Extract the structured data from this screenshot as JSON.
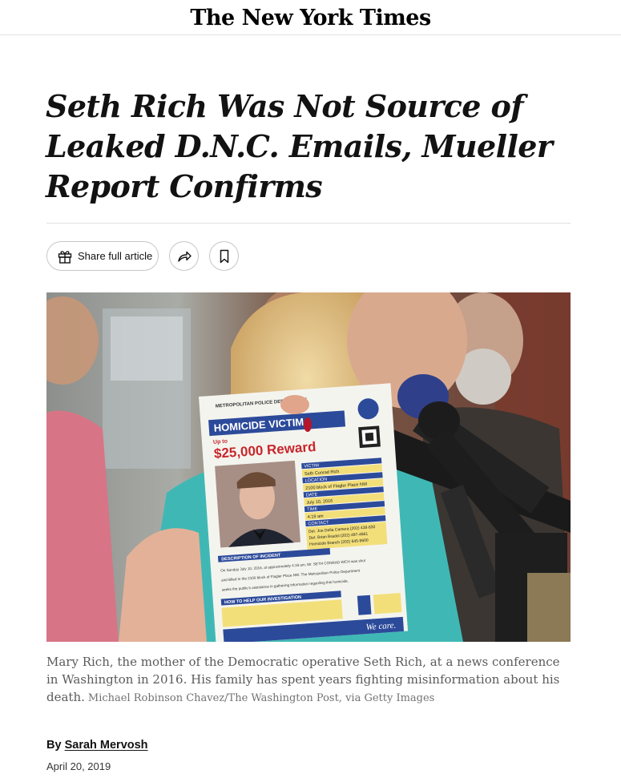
{
  "masthead": {
    "logo_text": "The New York Times"
  },
  "article": {
    "headline": "Seth Rich Was Not Source of Leaked D.N.C. Emails, Mueller Report Confirms",
    "toolbar": {
      "share_label": "Share full article"
    },
    "photo": {
      "poster": {
        "department": "METROPOLITAN POLICE DEPARTMENT",
        "banner": "HOMICIDE VICTIM",
        "up_to": "Up to",
        "reward": "$25,000 Reward",
        "fields": [
          "VICTIM",
          "Seth Conrad Rich",
          "LOCATION",
          "2100 block of Flagler Place NW",
          "DATE",
          "July 10, 2016",
          "TIME",
          "4:19 am",
          "CONTACT"
        ],
        "contacts": [
          "Det. Joe Della Camera  (202) 438-830",
          "Det. Brian Bradol  (202) 497-4661",
          "Homicide Branch  (202) 645-9600"
        ],
        "incident_heading": "DESCRIPTION OF INCIDENT",
        "incident_text": [
          "On Sunday July 10, 2016, at approximately 4:19 am, Mr. SETH CONRAD RICH was shot",
          "and killed in the 2100 block of Flagler Place NW. The Metropolitan Police Department",
          "seeks the public's assistance in gathering information regarding this homicide."
        ],
        "help_heading": "HOW TO HELP OUR INVESTIGATION",
        "footer": "We care."
      }
    },
    "caption": {
      "text": "Mary Rich, the mother of the Democratic operative Seth Rich, at a news conference in Washington in 2016. His family has spent years fighting misinformation about his death.",
      "credit": "Michael Robinson Chavez/The Washington Post, via Getty Images"
    },
    "byline": {
      "prefix": "By",
      "author": "Sarah Mervosh"
    },
    "date": "April 20, 2019"
  },
  "colors": {
    "text": "#121212",
    "caption": "#5a5a5a",
    "rule": "#dfdfdf",
    "poster_banner": "#2c4a9a",
    "poster_reward": "#c8262b"
  },
  "icons": [
    "gift-icon",
    "forward-arrow-icon",
    "bookmark-icon"
  ]
}
